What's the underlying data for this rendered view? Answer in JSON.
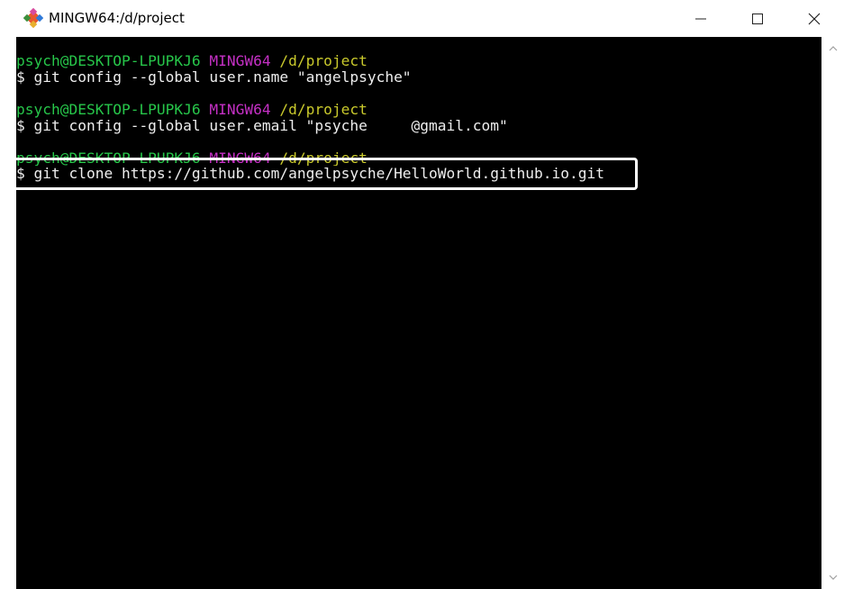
{
  "window": {
    "title": "MINGW64:/d/project"
  },
  "icons": {
    "app": "git-diamond-icon",
    "minimize": "minimize-icon",
    "maximize": "maximize-icon",
    "close": "close-icon",
    "scroll_up": "chevron-up-icon",
    "scroll_down": "chevron-down-icon"
  },
  "colors": {
    "prompt_user": "#27c64a",
    "prompt_env": "#c530c5",
    "prompt_path": "#c9c92c",
    "command": "#eeeeee",
    "background": "#000000"
  },
  "terminal": {
    "blocks": [
      {
        "user": "psych@DESKTOP-LPUPKJ6",
        "env": "MINGW64",
        "path": "/d/project",
        "command": "$ git config --global user.name \"angelpsyche\""
      },
      {
        "user": "psych@DESKTOP-LPUPKJ6",
        "env": "MINGW64",
        "path": "/d/project",
        "command": "$ git config --global user.email \"psyche     @gmail.com\""
      },
      {
        "user": "psych@DESKTOP-LPUPKJ6",
        "env": "MINGW64",
        "path": "/d/project",
        "command": "$ git clone https://github.com/angelpsyche/HelloWorld.github.io.git"
      }
    ]
  }
}
